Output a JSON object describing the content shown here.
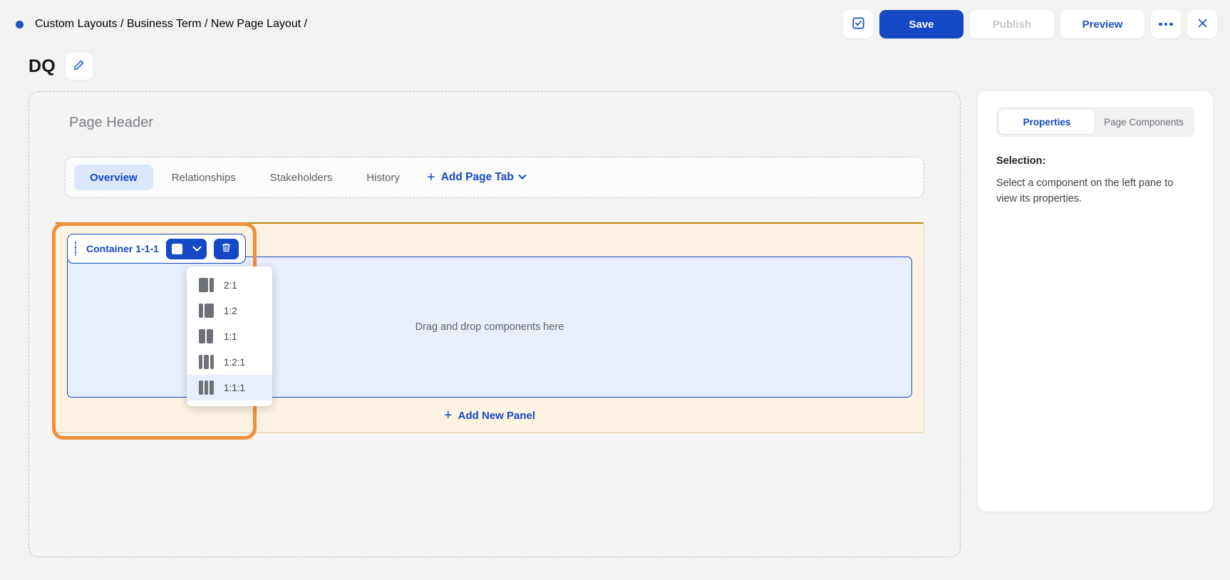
{
  "topbar": {
    "breadcrumb": "Custom Layouts / Business Term / New Page Layout /",
    "check_icon": "check-square-icon",
    "save_label": "Save",
    "publish_label": "Publish",
    "preview_label": "Preview",
    "more_icon": "ellipsis-icon",
    "close_icon": "close-icon"
  },
  "title": {
    "text": "DQ",
    "edit_icon": "pencil-icon"
  },
  "canvas": {
    "page_header_label": "Page Header",
    "tabs": [
      {
        "label": "Overview",
        "active": true
      },
      {
        "label": "Relationships",
        "active": false
      },
      {
        "label": "Stakeholders",
        "active": false
      },
      {
        "label": "History",
        "active": false
      }
    ],
    "add_tab_label": "Add Page Tab",
    "add_tab_plus": "+",
    "container": {
      "name": "Container 1-1-1",
      "drag_icon": "drag-handle-icon",
      "layout_icon": "single-column-icon",
      "caret_icon": "chevron-down-icon",
      "delete_icon": "trash-icon"
    },
    "dropzone_text": "Drag and drop components here",
    "add_panel_label": "Add New Panel",
    "add_panel_plus": "+"
  },
  "ratio_menu": {
    "items": [
      {
        "label": "2:1",
        "cols": [
          13,
          6
        ],
        "hover": false
      },
      {
        "label": "1:2",
        "cols": [
          6,
          13
        ],
        "hover": false
      },
      {
        "label": "1:1",
        "cols": [
          9,
          9
        ],
        "hover": false
      },
      {
        "label": "1:2:1",
        "cols": [
          5,
          8,
          5
        ],
        "hover": false
      },
      {
        "label": "1:1:1",
        "cols": [
          5.6,
          5.6,
          5.6
        ],
        "hover": true
      }
    ]
  },
  "properties": {
    "tabs": [
      {
        "label": "Properties",
        "active": true
      },
      {
        "label": "Page Components",
        "active": false
      }
    ],
    "selection_label": "Selection:",
    "selection_description": "Select a component on the left pane to view its properties."
  },
  "colors": {
    "brand_blue": "#1448c4",
    "selection_orange": "#f0903c",
    "panel_cream": "#fcf3e3",
    "panel_gold_border": "#b8860b",
    "dropzone_blue": "#e8effc",
    "page_bg": "#f2f2f2"
  }
}
